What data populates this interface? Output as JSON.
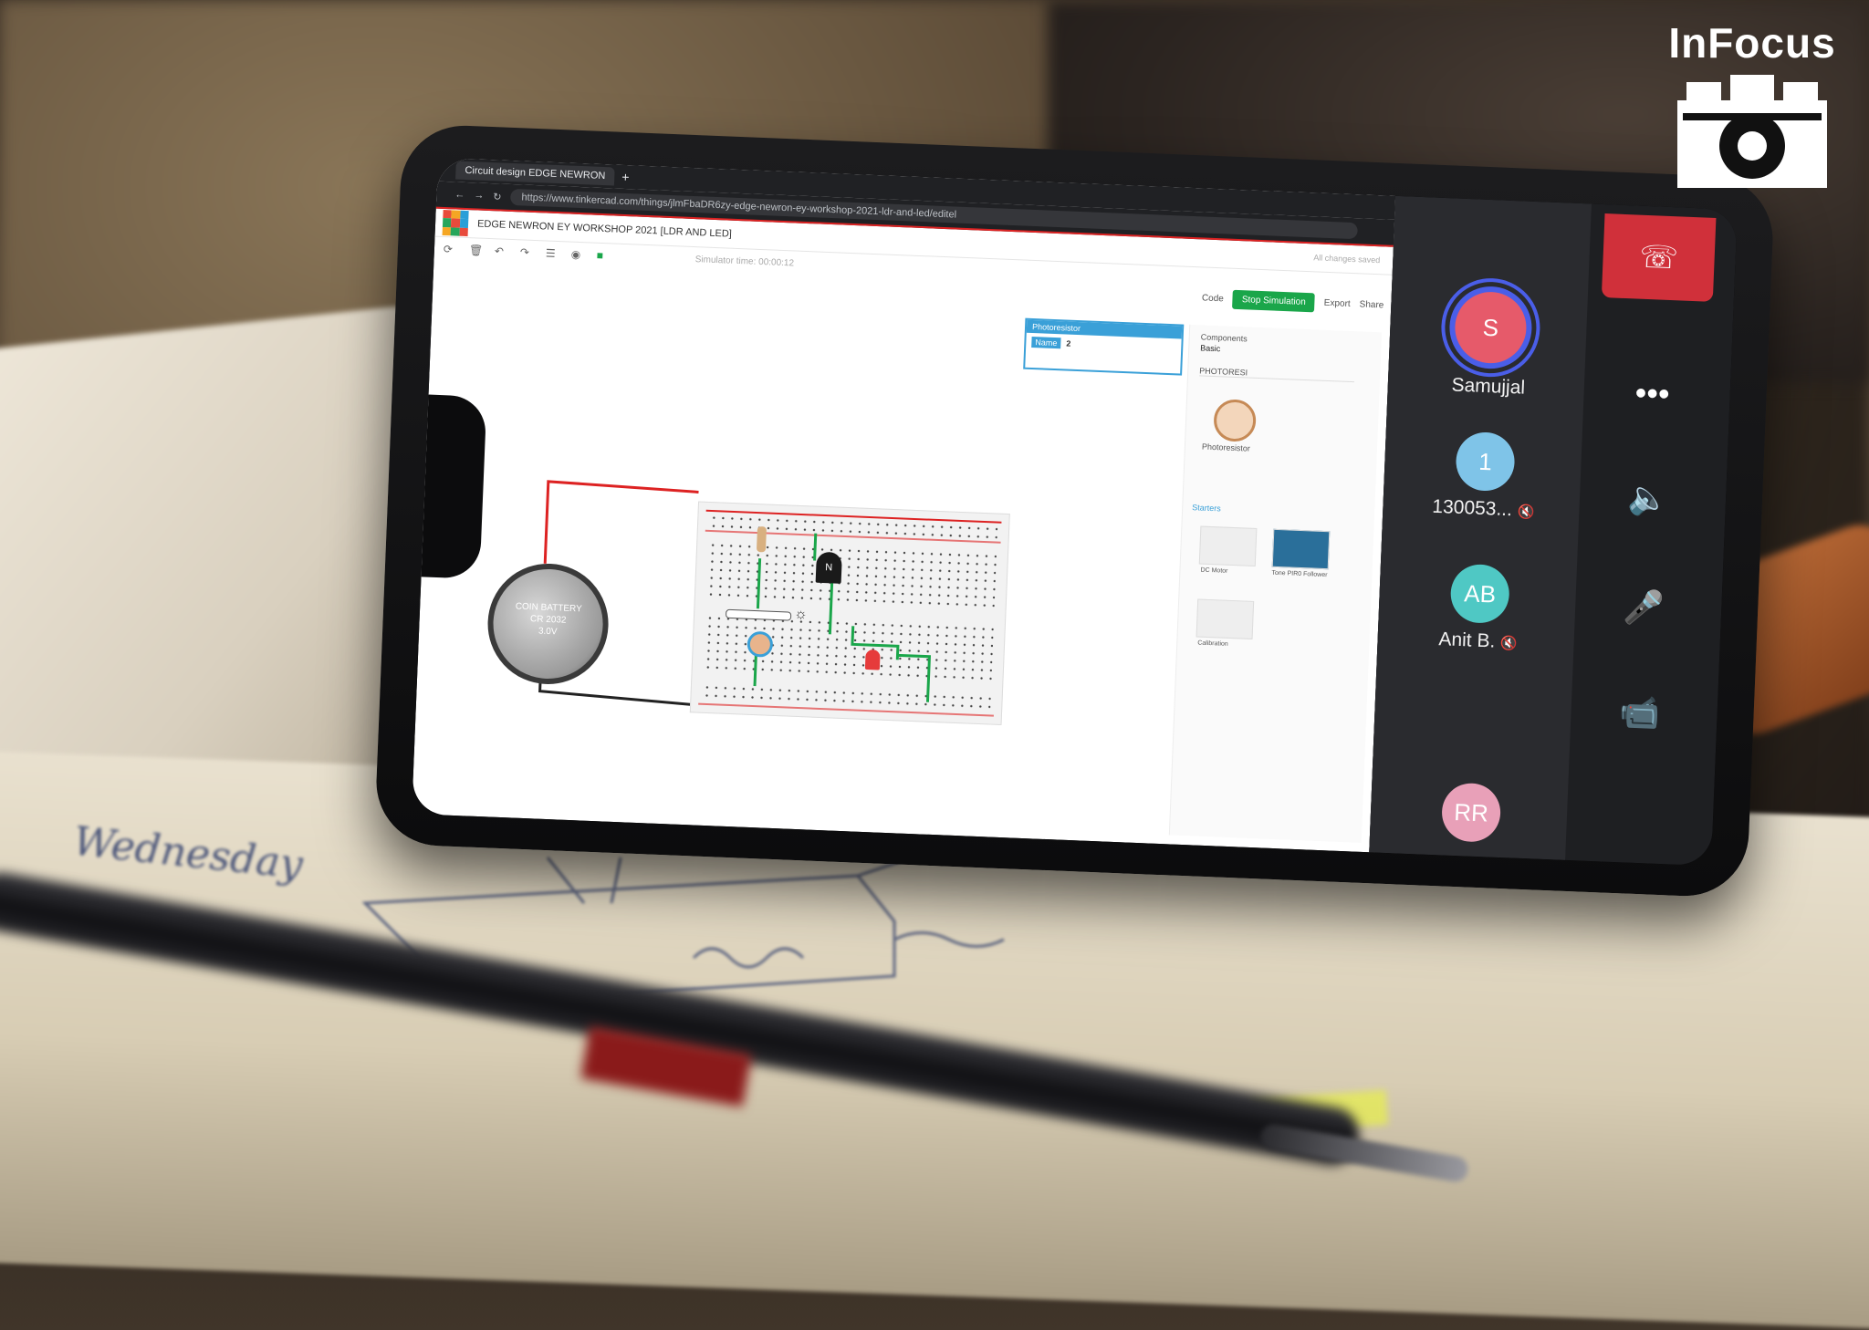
{
  "logo": {
    "text": "InFocus"
  },
  "browser": {
    "tab_title": "Circuit design EDGE NEWRON",
    "url": "https://www.tinkercad.com/things/jlmFbaDR6zy-edge-newron-ey-workshop-2021-ldr-and-led/editel"
  },
  "tinkercad": {
    "doc_title": "EDGE NEWRON EY WORKSHOP 2021 [LDR AND LED]",
    "simulator_time": "Simulator time: 00:00:12",
    "saved_status": "All changes saved",
    "code_label": "Code",
    "stop_simulation_label": "Stop Simulation",
    "export_label": "Export",
    "share_label": "Share",
    "properties": {
      "title": "Photoresistor",
      "name_label": "Name",
      "name_value": "2"
    },
    "components": {
      "label": "Components",
      "value": "Basic",
      "search": "PHOTORESI",
      "photoresistor_label": "Photoresistor",
      "starters_label": "Starters"
    },
    "starters": [
      "DC Motor",
      "Tone PIR0 Follower",
      "Calibration"
    ],
    "battery": {
      "line1": "COIN BATTERY",
      "line2": "CR 2032",
      "line3": "3.0V"
    },
    "transistor_label": "N"
  },
  "meet": {
    "participants": [
      {
        "initial": "S",
        "name": "Samujjal"
      },
      {
        "initial": "1",
        "name": "130053..."
      },
      {
        "initial": "AB",
        "name": "Anit B."
      },
      {
        "initial": "RR",
        "name": ""
      }
    ]
  },
  "notebook": {
    "weekday": "Wednesday"
  },
  "colors": {
    "hangup": "#d0303a",
    "sim_green": "#1aa64a",
    "accent_blue": "#3aa0d8",
    "led_red": "#e63b3b"
  }
}
